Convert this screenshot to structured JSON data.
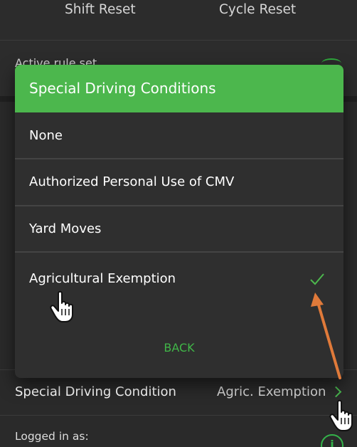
{
  "background": {
    "shift_reset": "Shift Reset",
    "cycle_reset": "Cycle Reset",
    "active_rule_set": "Active rule set",
    "special_driving_condition_label": "Special Driving Condition",
    "special_driving_condition_value": "Agric. Exemption",
    "logged_in_as": "Logged in as:"
  },
  "dialog": {
    "title": "Special Driving Conditions",
    "options": [
      {
        "label": "None",
        "selected": false
      },
      {
        "label": "Authorized Personal Use of CMV",
        "selected": false
      },
      {
        "label": "Yard Moves",
        "selected": false
      },
      {
        "label": "Agricultural Exemption",
        "selected": true
      }
    ],
    "back_label": "BACK"
  },
  "colors": {
    "accent_green": "#4cb74d",
    "arrow_orange": "#e07a3a",
    "dialog_bg": "#2f2f2f",
    "screen_bg": "#2a2a2a"
  },
  "icons": [
    "chevron-right-icon",
    "check-icon",
    "info-icon",
    "hand-pointer-icon",
    "arrow-annotation"
  ]
}
